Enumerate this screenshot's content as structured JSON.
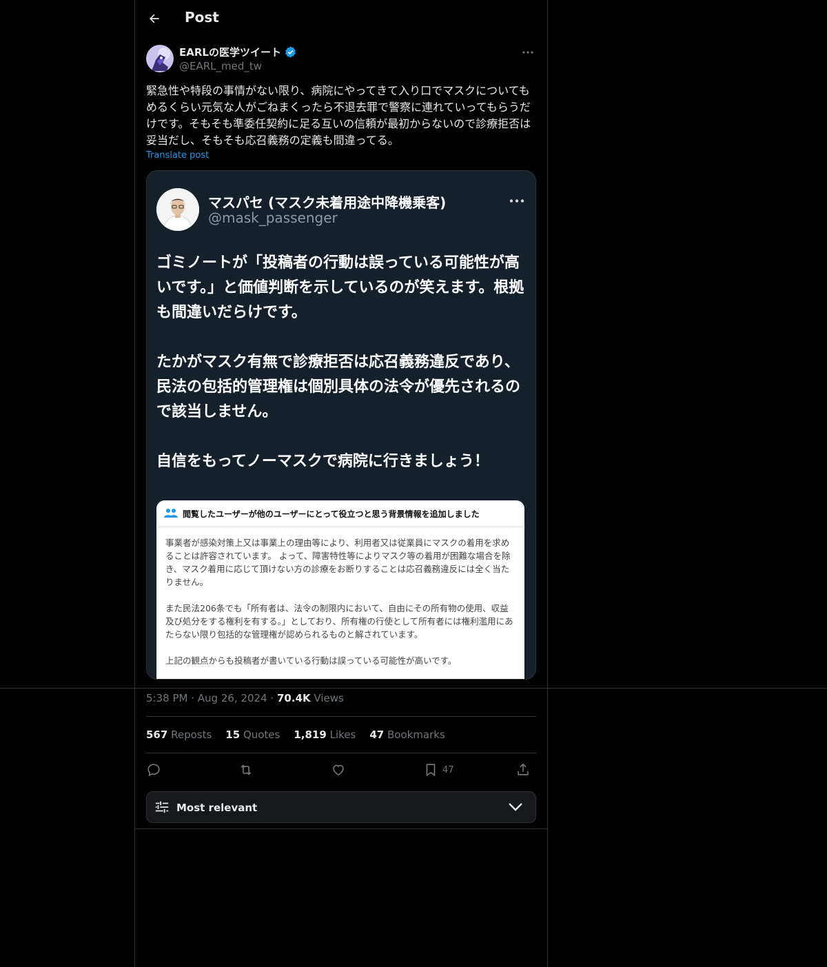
{
  "header": {
    "title": "Post"
  },
  "post": {
    "author_name": "EARLの医学ツイート",
    "author_handle": "@EARL_med_tw",
    "text": "緊急性や特段の事情がない限り、病院にやってきて入り口でマスクについてもめるくらい元気な人がごねまくったら不退去罪で警察に連れていってもらうだけです。そもそも準委任契約に足る互いの信頼が最初からないので診療拒否は妥当だし、そもそも応召義務の定義も間違ってる。",
    "translate_label": "Translate post",
    "time": "5:38 PM",
    "date": "Aug 26, 2024",
    "views_count": "70.4K",
    "views_label": "Views"
  },
  "quoted_image": {
    "name": "マスパセ (マスク未着用途中降機乗客)",
    "handle": "@mask_passenger",
    "paragraphs": [
      "ゴミノートが「投稿者の行動は誤っている可能性が高いです。」と価値判断を示しているのが笑えます。根拠も間違いだらけです。",
      "たかがマスク有無で診療拒否は応召義務違反であり、民法の包括的管理権は個別具体の法令が優先されるので該当しません。",
      "自信をもってノーマスクで病院に行きましょう！"
    ],
    "note_title": "閲覧したユーザーが他のユーザーにとって役立つと思う背景情報を追加しました",
    "note_paragraphs": [
      "事業者が感染対策上又は事業上の理由等により、利用者又は従業員にマスクの着用を求めることは許容されています。 よって、障害特性等によりマスク等の着用が困難な場合を除き、マスク着用に応じて頂けない方の診療をお断りすることは応召義務違反には全く当たりません。",
      "また民法206条でも「所有者は、法令の制限内において、自由にその所有物の使用、収益及び処分をする権利を有する。」としており、所有権の行使として所有者には権利濫用にあたらない限り包括的な管理権が認められるものと解されています。",
      "上記の観点からも投稿者が書いている行動は誤っている可能性が高いです。"
    ]
  },
  "stats": {
    "reposts_count": "567",
    "reposts_label": "Reposts",
    "quotes_count": "15",
    "quotes_label": "Quotes",
    "likes_count": "1,819",
    "likes_label": "Likes",
    "bookmarks_count": "47",
    "bookmarks_label": "Bookmarks"
  },
  "actions": {
    "bookmark_count": "47"
  },
  "sort": {
    "label": "Most relevant"
  },
  "colors": {
    "accent": "#1d9bf0",
    "background": "#000000",
    "border": "#2f3336",
    "muted": "#71767b"
  },
  "icons": [
    "back-arrow-icon",
    "verified-badge-icon",
    "more-icon",
    "reply-icon",
    "repost-icon",
    "like-icon",
    "bookmark-icon",
    "share-icon",
    "sliders-icon",
    "chevron-down-icon",
    "community-notes-icon"
  ]
}
